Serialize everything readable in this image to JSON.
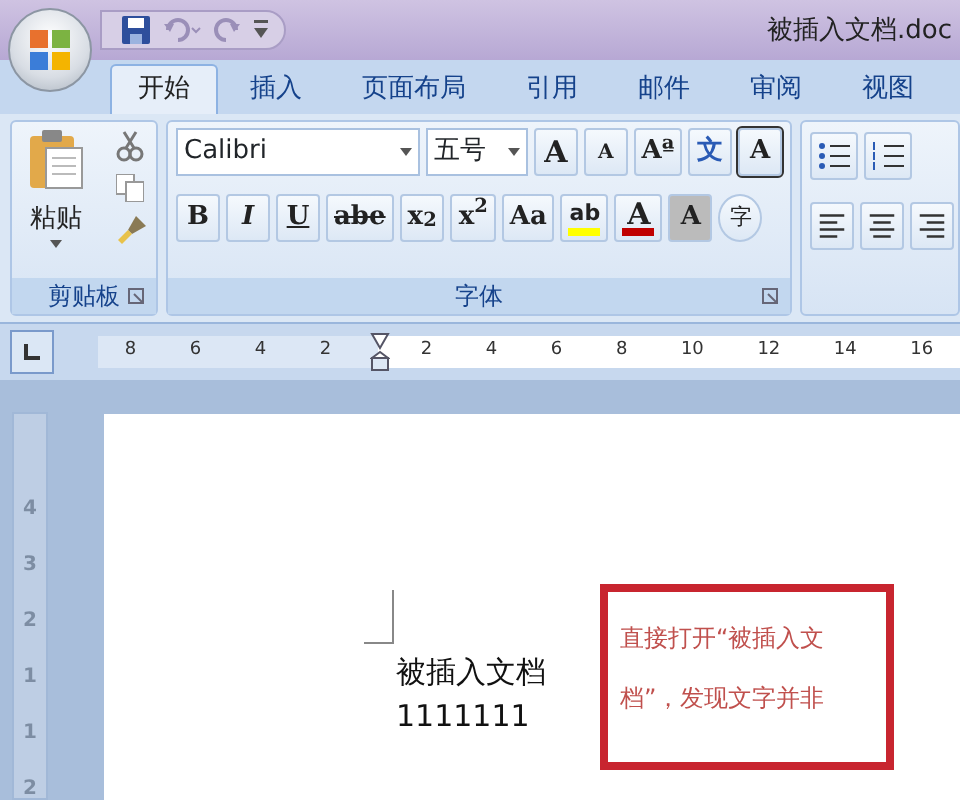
{
  "window": {
    "title": "被插入文档.doc"
  },
  "tabs": [
    {
      "label": "开始",
      "selected": true
    },
    {
      "label": "插入",
      "selected": false
    },
    {
      "label": "页面布局",
      "selected": false
    },
    {
      "label": "引用",
      "selected": false
    },
    {
      "label": "邮件",
      "selected": false
    },
    {
      "label": "审阅",
      "selected": false
    },
    {
      "label": "视图",
      "selected": false
    }
  ],
  "clipboard": {
    "paste_label": "粘贴",
    "label": "剪贴板"
  },
  "font": {
    "label": "字体",
    "font_name": "Calibri",
    "font_size": "五号",
    "top_buttons": [
      {
        "kind": "grow",
        "label": "A"
      },
      {
        "kind": "shrink",
        "label": "A"
      },
      {
        "kind": "clear",
        "label": "Aª"
      },
      {
        "kind": "phonetic",
        "label": "文"
      },
      {
        "kind": "border",
        "label": "A"
      }
    ],
    "format_buttons": [
      {
        "kind": "bold",
        "label": "B"
      },
      {
        "kind": "italic",
        "label": "I"
      },
      {
        "kind": "underline",
        "label": "U"
      },
      {
        "kind": "strike",
        "label": "abe"
      },
      {
        "kind": "sub",
        "label": "x$_{2}$"
      },
      {
        "kind": "sup",
        "label": "x$^{2}$"
      },
      {
        "kind": "case",
        "label": "Aa"
      }
    ],
    "color_buttons": [
      {
        "kind": "highlight",
        "label": "ab",
        "color": "#ffff00"
      },
      {
        "kind": "fontcolor",
        "label": "A",
        "color": "#c00000"
      }
    ],
    "extra_buttons": [
      {
        "kind": "shading",
        "label": "A"
      },
      {
        "kind": "enclose",
        "label": "字"
      }
    ]
  },
  "ruler": {
    "left_numbers": [
      "8",
      "6",
      "4",
      "2"
    ],
    "right_numbers": [
      "2",
      "4",
      "6",
      "8",
      "10",
      "12",
      "14",
      "16"
    ]
  },
  "vertical_ruler": {
    "numbers": [
      "4",
      "3",
      "2",
      "1",
      "1",
      "2"
    ]
  },
  "document": {
    "lines": [
      "被插入文档",
      "1111111"
    ]
  },
  "callout": {
    "lines": [
      "直接打开“被插入文",
      "档”，发现文字并非"
    ]
  }
}
